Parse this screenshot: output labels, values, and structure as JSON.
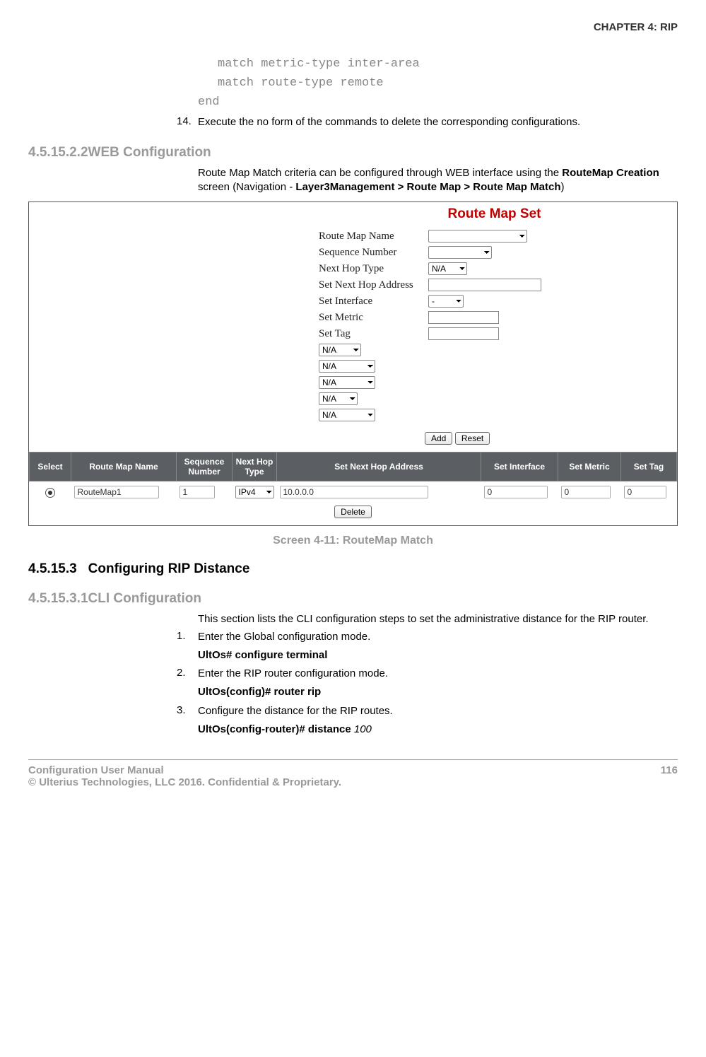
{
  "header": {
    "chapter": "CHAPTER 4: RIP"
  },
  "codeblock": {
    "l1": "match metric-type inter-area",
    "l2": "match route-type remote",
    "l3": "end"
  },
  "step14": {
    "num": "14.",
    "text": "Execute the no form of the commands to delete the corresponding configurations."
  },
  "sec_web": {
    "num": "4.5.15.2.2",
    "title": "WEB Configuration",
    "intro_a": "Route Map Match criteria can be configured through WEB interface using the ",
    "intro_b": "RouteMap Creation",
    "intro_c": " screen (Navigation - ",
    "intro_d": "Layer3Management > Route Map > Route Map Match",
    "intro_e": ")"
  },
  "screenshot": {
    "title": "Route Map Set",
    "labels": {
      "rmn": "Route Map Name",
      "seq": "Sequence Number",
      "nht": "Next Hop Type",
      "snha": "Set Next Hop Address",
      "si": "Set Interface",
      "sm": "Set Metric",
      "st": "Set Tag"
    },
    "na": "N/A",
    "dash": "-",
    "buttons": {
      "add": "Add",
      "reset": "Reset",
      "delete": "Delete"
    },
    "grid": {
      "headers": {
        "select": "Select",
        "rmn": "Route Map Name",
        "seq": "Sequence Number",
        "nht": "Next Hop Type",
        "snha": "Set Next Hop Address",
        "si": "Set Interface",
        "sm": "Set Metric",
        "st": "Set Tag"
      },
      "row": {
        "rmn": "RouteMap1",
        "seq": "1",
        "nht": "IPv4",
        "snha": "10.0.0.0",
        "si": "0",
        "sm": "0",
        "st": "0"
      }
    }
  },
  "caption": "Screen 4-11: RouteMap Match",
  "sec_dist": {
    "num": "4.5.15.3",
    "title": "Configuring RIP Distance"
  },
  "sec_cli": {
    "num": "4.5.15.3.1",
    "title": "CLI Configuration",
    "intro": "This section lists the CLI configuration steps to set the administrative distance for the RIP router.",
    "steps": {
      "s1n": "1.",
      "s1t": "Enter the Global configuration mode.",
      "s1c": "UltOs# configure terminal",
      "s2n": "2.",
      "s2t": "Enter the RIP router configuration mode.",
      "s2c": "UltOs(config)# router rip",
      "s3n": "3.",
      "s3t": "Configure the distance for the RIP routes.",
      "s3c_a": "UltOs(config-router)# distance ",
      "s3c_b": "100"
    }
  },
  "footer": {
    "left1": "Configuration User Manual",
    "left2": "© Ulterius Technologies, LLC 2016. Confidential & Proprietary.",
    "page": "116"
  }
}
